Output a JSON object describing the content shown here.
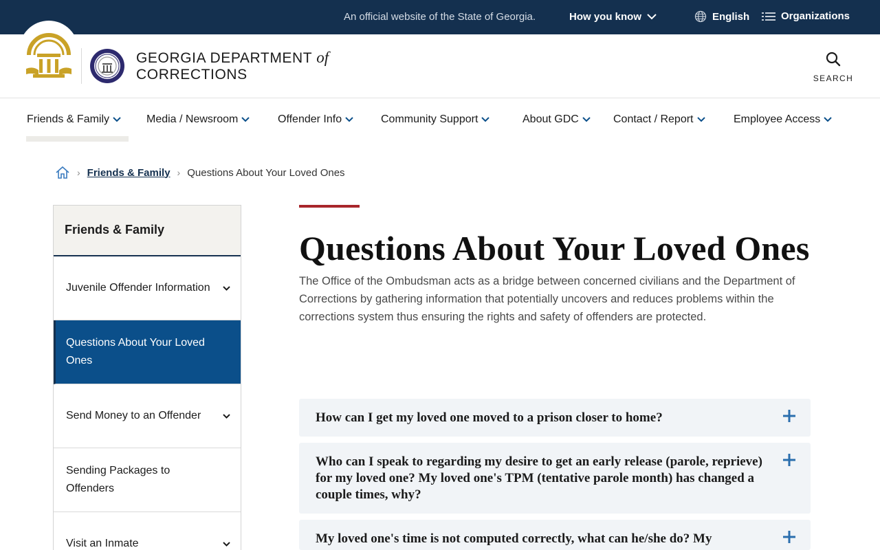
{
  "topbar": {
    "official_text": "An official website of the State of Georgia.",
    "how_you_know": "How you know",
    "language": "English",
    "organizations": "Organizations"
  },
  "header": {
    "agency_line1": "GEORGIA DEPARTMENT",
    "agency_of": "of",
    "agency_line2": "CORRECTIONS",
    "search_label": "SEARCH"
  },
  "nav": {
    "items": [
      {
        "label": "Friends & Family",
        "active": true
      },
      {
        "label": "Media / Newsroom"
      },
      {
        "label": "Offender Info"
      },
      {
        "label": "Community Support"
      },
      {
        "label": "About GDC"
      },
      {
        "label": "Contact / Report"
      },
      {
        "label": "Employee Access"
      }
    ]
  },
  "breadcrumb": {
    "parent": "Friends & Family",
    "current": "Questions About Your Loved Ones"
  },
  "sidebar": {
    "heading": "Friends & Family",
    "items": [
      {
        "label": "Juvenile Offender Information",
        "expandable": true
      },
      {
        "label": "Questions About Your Loved Ones",
        "active": true
      },
      {
        "label": "Send Money to an Offender",
        "expandable": true
      },
      {
        "label": "Sending Packages to Offenders"
      },
      {
        "label": "Visit an Inmate",
        "expandable": true
      }
    ]
  },
  "main": {
    "title": "Questions About Your Loved Ones",
    "intro": "The Office of the Ombudsman acts as a bridge between concerned civilians and the Department of Corrections by gathering information that potentially uncovers and reduces problems within the corrections system thus ensuring the rights and safety of offenders are protected.",
    "faqs": [
      {
        "question": "How can I get my loved one moved to a prison closer to home?"
      },
      {
        "question": "Who can I speak to regarding my desire to get an early release (parole, reprieve) for my loved one? My loved one's TPM (tentative parole month) has changed a couple times, why?"
      },
      {
        "question": "My loved one's time is not computed correctly, what can he/she do? My"
      }
    ]
  },
  "colors": {
    "navy": "#14304f",
    "active_blue": "#0b4f8a",
    "accent_red": "#a8262b",
    "plus_blue": "#2a6ead",
    "gold": "#c9a227"
  }
}
